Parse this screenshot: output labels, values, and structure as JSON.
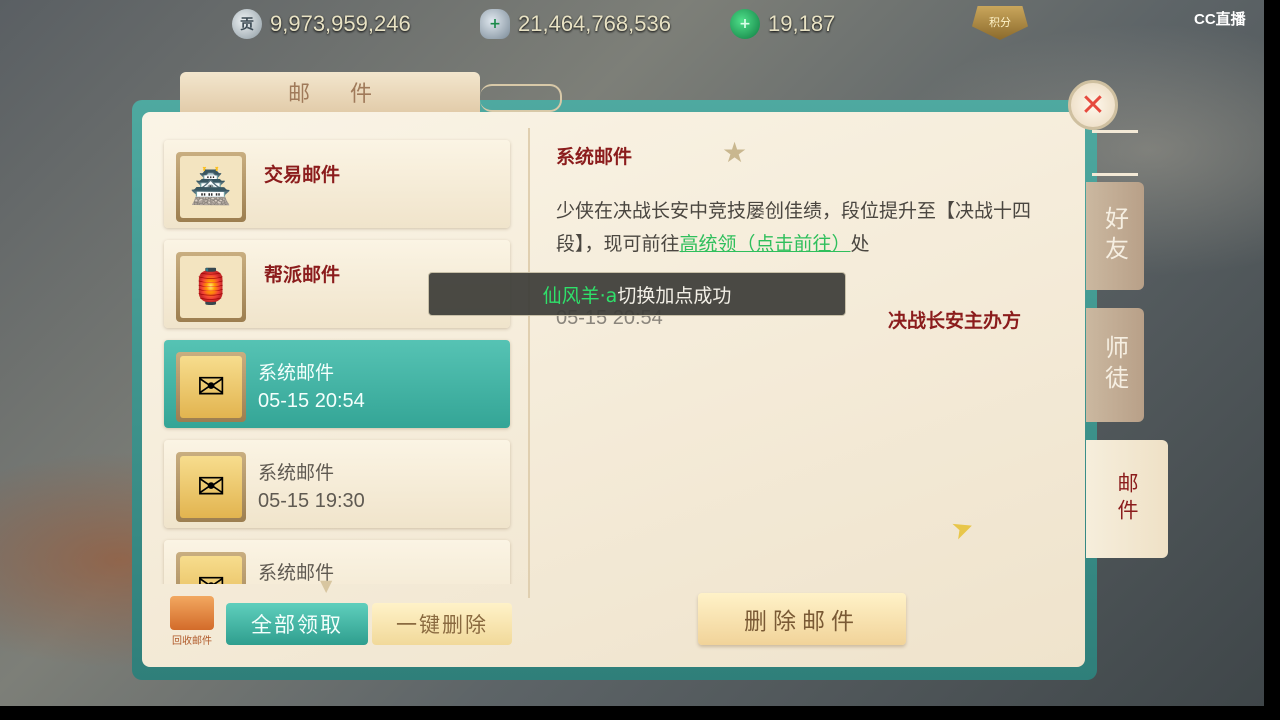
{
  "currencies": {
    "silver": {
      "icon": "coin-silver-icon",
      "glyph": "贡",
      "value": "9,973,959,246"
    },
    "ingot": {
      "icon": "silver-ingot-icon",
      "glyph": "+",
      "value": "21,464,768,536"
    },
    "jade": {
      "icon": "jade-icon",
      "glyph": "+",
      "value": "19,187"
    }
  },
  "rank_badge": "积分",
  "watermark": "CC直播",
  "panel": {
    "title": "邮件",
    "close_glyph": "✕"
  },
  "mail_list": [
    {
      "title": "交易邮件",
      "date": "",
      "icon": "market-icon",
      "glyph": "🏯",
      "type": "trade"
    },
    {
      "title": "帮派邮件",
      "date": "",
      "icon": "guild-icon",
      "glyph": "🏮",
      "type": "guild"
    },
    {
      "title": "系统邮件",
      "date": "05-15 20:54",
      "icon": "envelope-icon",
      "glyph": "✉",
      "type": "system",
      "selected": true
    },
    {
      "title": "系统邮件",
      "date": "05-15 19:30",
      "icon": "envelope-icon",
      "glyph": "✉",
      "type": "system"
    },
    {
      "title": "系统邮件",
      "date": "",
      "icon": "envelope-icon",
      "glyph": "✉",
      "type": "system"
    }
  ],
  "detail": {
    "title": "系统邮件",
    "body_before": "少侠在决战长安中竞技屡创佳绩，段位提升至【决战十四段】，现可前往",
    "link": "高统领（点击前往）",
    "body_after": "处",
    "date": "05-15 20:54",
    "sender": "决战长安主办方"
  },
  "toast": {
    "name": "仙风羊·a",
    "message": "切换加点成功"
  },
  "buttons": {
    "recycle": "回收邮件",
    "collect_all": "全部领取",
    "delete_all": "一键删除",
    "delete_mail": "删除邮件"
  },
  "side_tabs": [
    {
      "label": "好友",
      "key": "friends"
    },
    {
      "label": "师徒",
      "key": "master"
    },
    {
      "label": "邮件",
      "key": "mail",
      "active": true
    }
  ],
  "colors": {
    "accent_teal": "#3fb3a3",
    "title_red": "#8b1c1c",
    "link_green": "#2fbf5c",
    "close_red": "#e64a3e"
  }
}
